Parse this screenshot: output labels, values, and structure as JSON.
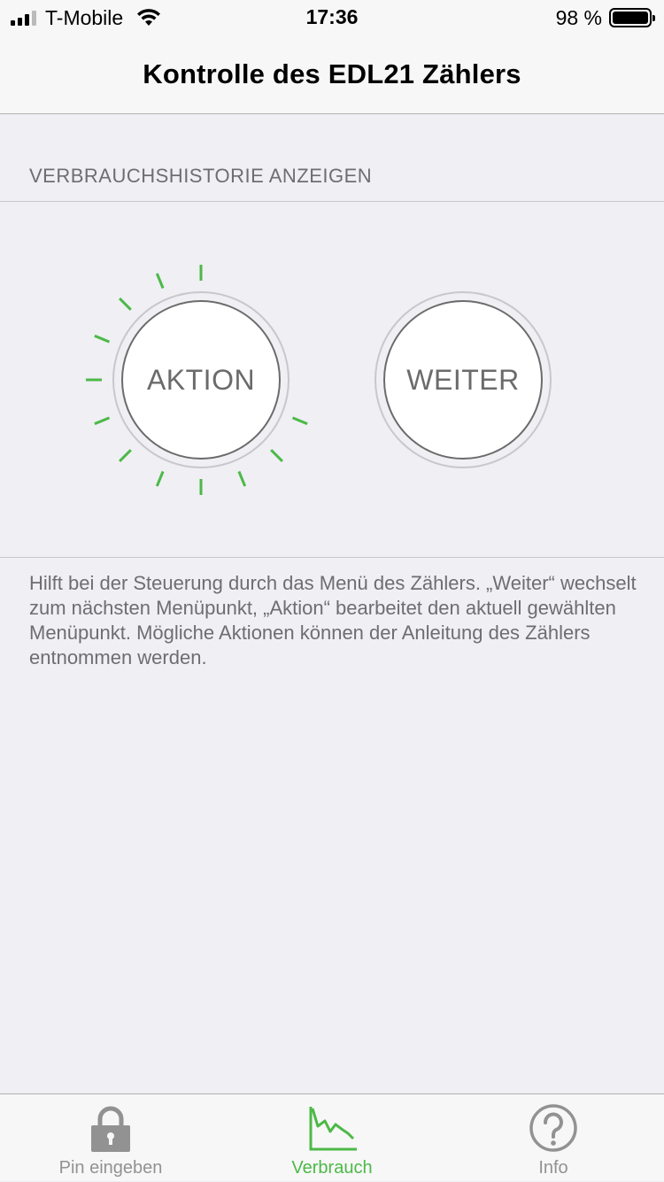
{
  "status_bar": {
    "carrier": "T-Mobile",
    "time": "17:36",
    "battery_percent": "98 %"
  },
  "nav": {
    "title": "Kontrolle des EDL21 Zählers"
  },
  "section": {
    "header": "VERBRAUCHSHISTORIE ANZEIGEN",
    "action_button": "AKTION",
    "next_button": "WEITER",
    "footer": "Hilft bei der Steuerung durch das Menü des Zählers. „Weiter“ wechselt zum nächsten Menüpunkt, „Aktion“ bearbeitet den aktuell gewählten Menüpunkt. Mögliche Aktionen können der Anleitung des Zählers entnommen werden."
  },
  "tabs": [
    {
      "label": "Pin eingeben",
      "icon": "lock-icon",
      "active": false
    },
    {
      "label": "Verbrauch",
      "icon": "chart-icon",
      "active": true
    },
    {
      "label": "Info",
      "icon": "question-icon",
      "active": false
    }
  ],
  "colors": {
    "accent": "#4cb947",
    "inactive_tab": "#929292",
    "background": "#efeff4"
  }
}
